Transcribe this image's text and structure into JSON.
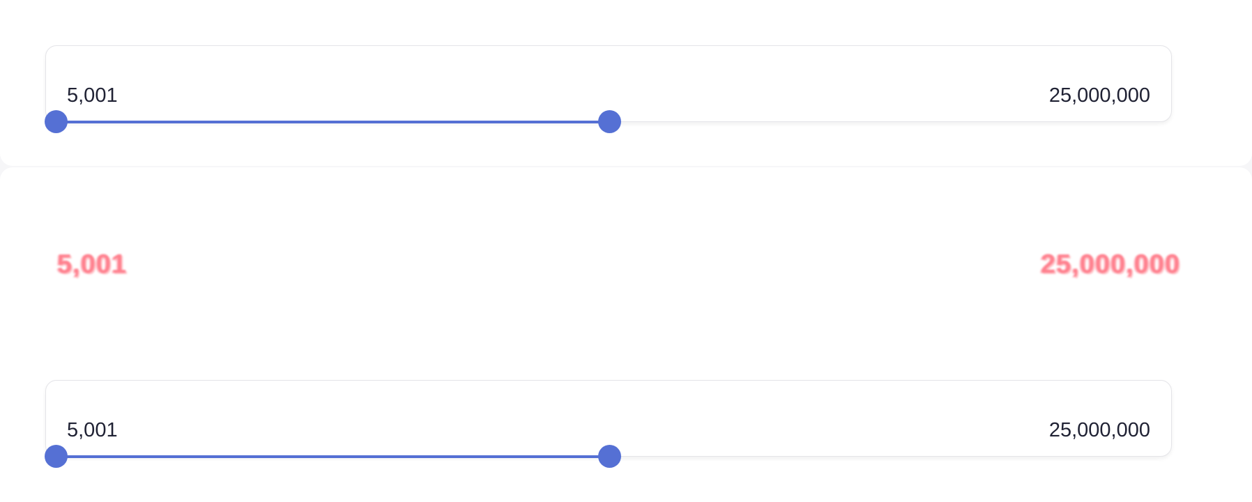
{
  "slider_top": {
    "min_label": "5,001",
    "max_label": "25,000,000",
    "range_min": 5001,
    "range_max": 25000000,
    "selected_fraction": 0.5
  },
  "ghost_labels": {
    "min_label": "5,001",
    "max_label": "25,000,000"
  },
  "slider_bottom": {
    "min_label": "5,001",
    "max_label": "25,000,000",
    "range_min": 5001,
    "range_max": 25000000,
    "selected_fraction": 0.5
  },
  "colors": {
    "accent": "#5570d4",
    "ghost_text": "#ff6a7a"
  }
}
